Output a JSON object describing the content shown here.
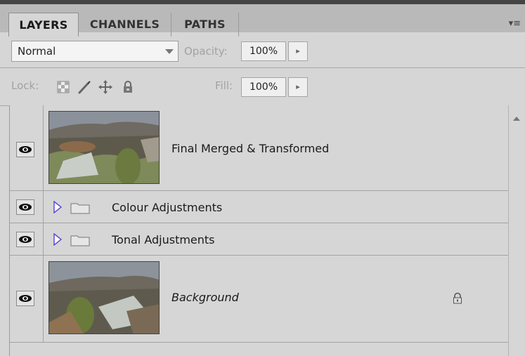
{
  "tabs": [
    {
      "label": "LAYERS",
      "active": true
    },
    {
      "label": "CHANNELS",
      "active": false
    },
    {
      "label": "PATHS",
      "active": false
    }
  ],
  "panel_menu_icon": "panel-menu-icon",
  "blend": {
    "mode": "Normal",
    "opacity_label": "Opacity:",
    "opacity_value": "100%"
  },
  "lock": {
    "label": "Lock:",
    "fill_label": "Fill:",
    "fill_value": "100%",
    "icons": [
      "lock-transparent-pixels-icon",
      "lock-image-pixels-icon",
      "lock-position-icon",
      "lock-all-icon"
    ]
  },
  "layers": [
    {
      "name": "Final Merged & Transformed",
      "type": "pixel",
      "visible": true
    },
    {
      "name": "Colour Adjustments",
      "type": "group",
      "visible": true
    },
    {
      "name": "Tonal Adjustments",
      "type": "group",
      "visible": true
    },
    {
      "name": "Background",
      "type": "background",
      "visible": true,
      "locked": true
    }
  ],
  "colors": {
    "panel_bg": "#d6d6d6",
    "tab_strip": "#b9b9b9",
    "disclosure_triangle": "#5b4fd1"
  }
}
